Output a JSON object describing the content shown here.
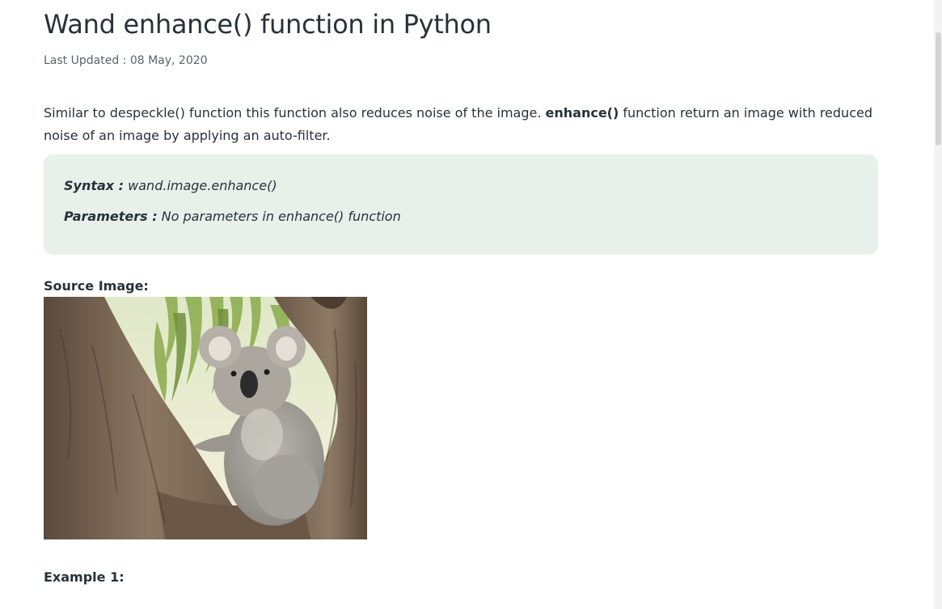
{
  "article": {
    "title": "Wand enhance() function in Python",
    "last_updated": "Last Updated : 08 May, 2020",
    "intro_part1": "Similar to despeckle() function this function also reduces noise of the image. ",
    "intro_bold": "enhance()",
    "intro_part2": " function return an image with reduced noise of an image by applying an auto-filter.",
    "syntax": {
      "syntax_label": "Syntax :",
      "syntax_value": " wand.image.enhance()",
      "params_label": "Parameters :",
      "params_value": " No parameters in enhance() function"
    },
    "source_image_label": "Source Image:",
    "example_label": "Example 1:"
  },
  "colors": {
    "text": "#273239",
    "muted": "#5b6369",
    "syntax_bg": "#e7f1ea"
  }
}
